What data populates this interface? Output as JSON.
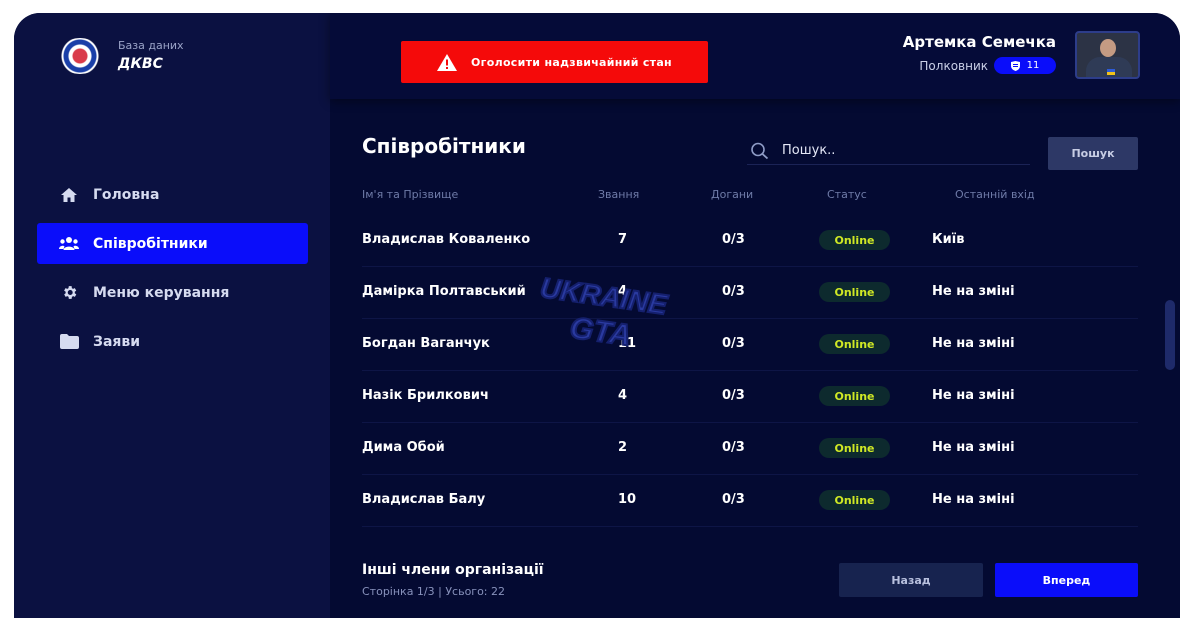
{
  "brand": {
    "subtitle": "База даних",
    "title": "ДКВС"
  },
  "sidebar": {
    "items": [
      {
        "label": "Головна",
        "icon": "home-icon",
        "active": false
      },
      {
        "label": "Співробітники",
        "icon": "users-icon",
        "active": true
      },
      {
        "label": "Меню керування",
        "icon": "gear-icon",
        "active": false
      },
      {
        "label": "Заяви",
        "icon": "folder-icon",
        "active": false
      }
    ]
  },
  "header": {
    "alarm_label": "Оголосити надзвичайний стан",
    "user": {
      "name": "Артемка Семечка",
      "rank": "Полковник",
      "badge": "11"
    }
  },
  "main": {
    "title": "Співробітники",
    "search": {
      "placeholder": "Пошук..",
      "button_label": "Пошук"
    },
    "columns": [
      "Ім'я та Прізвище",
      "Звання",
      "Догани",
      "Статус",
      "Останній вхід"
    ],
    "rows": [
      {
        "name": "Владислав Коваленко",
        "rank": "7",
        "warnings": "0/3",
        "status": "Online",
        "last": "Київ"
      },
      {
        "name": "Дамірка Полтавський",
        "rank": "4",
        "warnings": "0/3",
        "status": "Online",
        "last": "Не на зміні"
      },
      {
        "name": "Богдан Ваганчук",
        "rank": "11",
        "warnings": "0/3",
        "status": "Online",
        "last": "Не на зміні"
      },
      {
        "name": "Назік Брилкович",
        "rank": "4",
        "warnings": "0/3",
        "status": "Online",
        "last": "Не на зміні"
      },
      {
        "name": "Дима Обой",
        "rank": "2",
        "warnings": "0/3",
        "status": "Online",
        "last": "Не на зміні"
      },
      {
        "name": "Владислав Балу",
        "rank": "10",
        "warnings": "0/3",
        "status": "Online",
        "last": "Не на зміні"
      }
    ],
    "footer": {
      "title": "Інші члени організації",
      "page_info": "Сторінка 1/3 | Усього: 22",
      "back_label": "Назад",
      "next_label": "Вперед"
    }
  },
  "watermark": {
    "line1": "UKRAINE",
    "line2": "GTA"
  },
  "colors": {
    "background": "#040a32",
    "sidebar": "#0b1141",
    "accent": "#0a0dfa",
    "alarm": "#f50a0a",
    "online_text": "#cfe825"
  }
}
